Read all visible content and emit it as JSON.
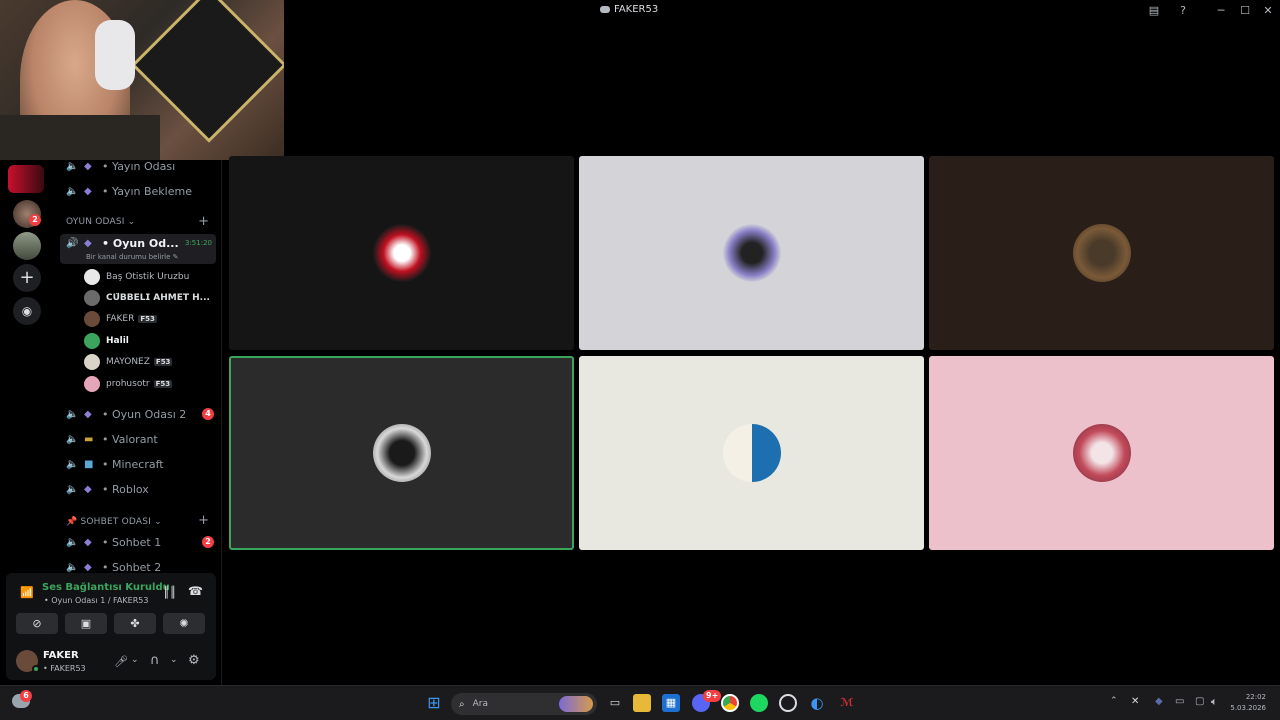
{
  "window": {
    "title": "FAKER53"
  },
  "sidebar": {
    "top_channels": [
      {
        "label": "• Yayın Odası"
      },
      {
        "label": "• Yayın Bekleme"
      }
    ],
    "categories": {
      "oyun": "OYUN ODASI ⌄",
      "sohbet": "SOHBET ODASI ⌄"
    },
    "active_channel": {
      "label": "• Oyun Od...",
      "timer": "3:51:20",
      "status_hint": "Bir kanal durumu belirle ✎"
    },
    "members": [
      {
        "name": "Baş Otistik Uruzbu",
        "tag": ""
      },
      {
        "name": "𝗖𝗨̈𝗕𝗕𝗘𝗟𝗜 𝗔𝗛𝗠𝗘𝗧 𝗛...",
        "tag": ""
      },
      {
        "name": "FAKER",
        "tag": "F53"
      },
      {
        "name": "Halil",
        "tag": ""
      },
      {
        "name": "MAYONEZ",
        "tag": "F53"
      },
      {
        "name": "prohusotr",
        "tag": "F53"
      }
    ],
    "channels": [
      {
        "label": "• Oyun Odası 2",
        "badge": "4"
      },
      {
        "label": "• Valorant",
        "badge": ""
      },
      {
        "label": "• Minecraft",
        "badge": ""
      },
      {
        "label": "• Roblox",
        "badge": ""
      }
    ],
    "sohbet_channels": [
      {
        "label": "• Sohbet 1",
        "badge": "2"
      },
      {
        "label": "• Sohbet 2",
        "badge": ""
      }
    ]
  },
  "rail": {
    "server_badge": "2"
  },
  "voice": {
    "status": "Ses Bağlantısı Kuruldu",
    "channel": "• Oyun Odası 1 / FAKER53"
  },
  "user": {
    "name": "FAKER",
    "status": "• FAKER53"
  },
  "taskbar": {
    "search_placeholder": "Ara",
    "discord_badge": "9+",
    "time": "22:02",
    "date": "5.03.2026"
  },
  "tiles": [
    {
      "bg": "#151515",
      "speaking": false
    },
    {
      "bg": "#d4d4d8",
      "speaking": false
    },
    {
      "bg": "#2a1e18",
      "speaking": false
    },
    {
      "bg": "#2b2b2b",
      "speaking": true
    },
    {
      "bg": "#e9e8e0",
      "speaking": false
    },
    {
      "bg": "#ecc1cc",
      "speaking": false
    }
  ]
}
